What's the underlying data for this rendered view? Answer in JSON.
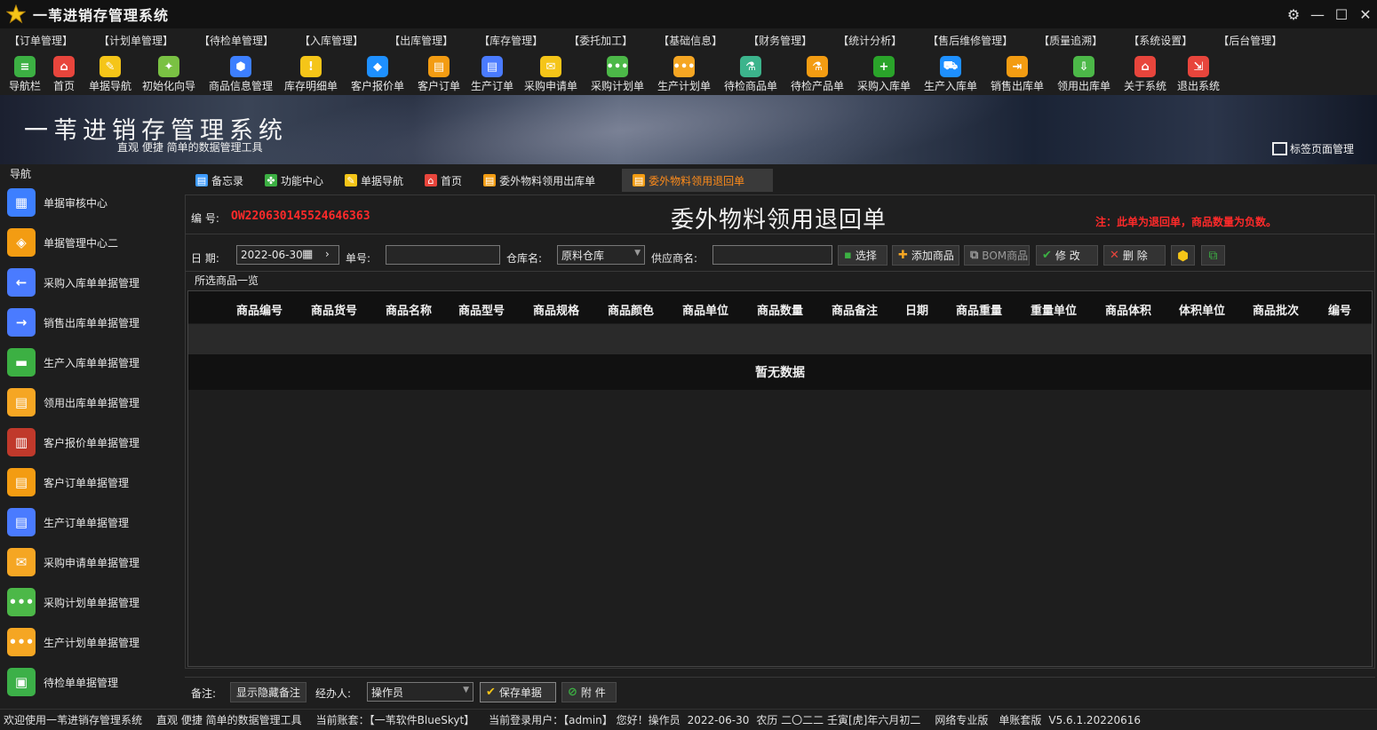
{
  "window": {
    "title": "一苇进销存管理系统",
    "controls": [
      "⚙",
      "—",
      "☐",
      "✕"
    ]
  },
  "menu": [
    "【订单管理】",
    "【计划单管理】",
    "【待检单管理】",
    "【入库管理】",
    "【出库管理】",
    "【库存管理】",
    "【委托加工】",
    "【基础信息】",
    "【财务管理】",
    "【统计分析】",
    "【售后维修管理】",
    "【质量追溯】",
    "【系统设置】",
    "【后台管理】"
  ],
  "toolbar": [
    {
      "label": "导航栏",
      "icon": "hamburger-icon",
      "color": "#3cb043"
    },
    {
      "label": "首页",
      "icon": "home-icon",
      "color": "#e8453c"
    },
    {
      "label": "单据导航",
      "icon": "pen-icon",
      "color": "#f5c518"
    },
    {
      "label": "初始化向导",
      "icon": "magic-wand-icon",
      "color": "#7ac143"
    },
    {
      "label": "商品信息管理",
      "icon": "cubes-icon",
      "color": "#3d7fff"
    },
    {
      "label": "库存明细单",
      "icon": "warning-icon",
      "color": "#f5c518"
    },
    {
      "label": "客户报价单",
      "icon": "tag-icon",
      "color": "#1e90ff"
    },
    {
      "label": "客户订单",
      "icon": "document-icon",
      "color": "#f39c12"
    },
    {
      "label": "生产订单",
      "icon": "document-icon",
      "color": "#4a7bff"
    },
    {
      "label": "采购申请单",
      "icon": "form-icon",
      "color": "#f5c518"
    },
    {
      "label": "采购计划单",
      "icon": "chat-icon",
      "color": "#4cb848"
    },
    {
      "label": "生产计划单",
      "icon": "chat-icon",
      "color": "#f5a623"
    },
    {
      "label": "待检商品单",
      "icon": "flask-icon",
      "color": "#3cb48c"
    },
    {
      "label": "待检产品单",
      "icon": "flask-icon",
      "color": "#f39c12"
    },
    {
      "label": "采购入库单",
      "icon": "plus-circle-icon",
      "color": "#2aa42a"
    },
    {
      "label": "生产入库单",
      "icon": "cart-icon",
      "color": "#1e90ff"
    },
    {
      "label": "销售出库单",
      "icon": "export-icon",
      "color": "#f39c12"
    },
    {
      "label": "领用出库单",
      "icon": "download-icon",
      "color": "#4cb848"
    },
    {
      "label": "关于系统",
      "icon": "house-icon",
      "color": "#e8453c"
    },
    {
      "label": "退出系统",
      "icon": "exit-icon",
      "color": "#e8453c"
    }
  ],
  "banner": {
    "title": "一苇进销存管理系统",
    "subtitle": "直观 便捷 简单的数据管理工具",
    "tab_manager": "标签页面管理"
  },
  "sidenav": {
    "title": "导航",
    "items": [
      {
        "label": "单据审核中心",
        "color": "#3d7fff",
        "icon": "grid-icon"
      },
      {
        "label": "单据管理中心二",
        "color": "#f39c12",
        "icon": "grid-diamond-icon"
      },
      {
        "label": "采购入库单单据管理",
        "color": "#4a7bff",
        "icon": "arrow-left-icon"
      },
      {
        "label": "销售出库单单据管理",
        "color": "#4a7bff",
        "icon": "arrow-right-icon"
      },
      {
        "label": "生产入库单单据管理",
        "color": "#3cb043",
        "icon": "box-icon"
      },
      {
        "label": "领用出库单单据管理",
        "color": "#f5a623",
        "icon": "inbox-icon"
      },
      {
        "label": "客户报价单单据管理",
        "color": "#c0392b",
        "icon": "books-icon"
      },
      {
        "label": "客户订单单据管理",
        "color": "#f39c12",
        "icon": "document-icon"
      },
      {
        "label": "生产订单单据管理",
        "color": "#4a7bff",
        "icon": "document-icon"
      },
      {
        "label": "采购申请单单据管理",
        "color": "#f5a623",
        "icon": "envelope-icon"
      },
      {
        "label": "采购计划单单据管理",
        "color": "#4cb848",
        "icon": "chat-icon"
      },
      {
        "label": "生产计划单单据管理",
        "color": "#f5a623",
        "icon": "chat-icon"
      },
      {
        "label": "待检单单据管理",
        "color": "#3cb048",
        "icon": "clipboard-icon"
      }
    ]
  },
  "tabs": [
    {
      "label": "备忘录",
      "icon": "memo-icon",
      "color": "#3d9bff",
      "active": false
    },
    {
      "label": "功能中心",
      "icon": "apps-icon",
      "color": "#3cb043",
      "active": false
    },
    {
      "label": "单据导航",
      "icon": "pen-icon",
      "color": "#f5c518",
      "active": false
    },
    {
      "label": "首页",
      "icon": "home-icon",
      "color": "#e8453c",
      "active": false
    },
    {
      "label": "委外物料领用出库单",
      "icon": "doc-icon",
      "color": "#f39c12",
      "active": false
    },
    {
      "label": "委外物料领用退回单",
      "icon": "doc-icon",
      "color": "#f39c12",
      "active": true
    }
  ],
  "form": {
    "no_label": "编 号:",
    "no_value": "OW220630145524646363",
    "title": "委外物料领用退回单",
    "note": "注：此单为退回单，商品数量为负数。",
    "date_label": "日 期:",
    "date_value": "2022-06-30",
    "order_label": "单号:",
    "order_value": "",
    "warehouse_label": "仓库名:",
    "warehouse_value": "原料仓库",
    "supplier_label": "供应商名:",
    "supplier_value": "",
    "buttons": {
      "select": "选择",
      "add": "添加商品",
      "bom": "BOM商品",
      "modify": "修 改",
      "delete": "删 除"
    },
    "grid_title": "所选商品一览",
    "columns": [
      "商品编号",
      "商品货号",
      "商品名称",
      "商品型号",
      "商品规格",
      "商品颜色",
      "商品单位",
      "商品数量",
      "商品备注",
      "日期",
      "商品重量",
      "重量单位",
      "商品体积",
      "体积单位",
      "商品批次",
      "编号"
    ],
    "no_data": "暂无数据",
    "remark_label": "备注:",
    "toggle_remark": "显示隐藏备注",
    "handler_label": "经办人:",
    "handler_value": "操作员",
    "save": "保存单据",
    "attach": "附 件"
  },
  "status": {
    "welcome": "欢迎使用一苇进销存管理系统",
    "slogan": "直观 便捷 简单的数据管理工具",
    "account": "当前账套：【一苇软件BlueSkyt】",
    "user": "当前登录用户：【admin】 您好！操作员",
    "date": "2022-06-30",
    "lunar": "农历 二〇二二 壬寅[虎]年六月初二",
    "edition": "网络专业版",
    "set": "单账套版",
    "version": "V5.6.1.20220616"
  }
}
